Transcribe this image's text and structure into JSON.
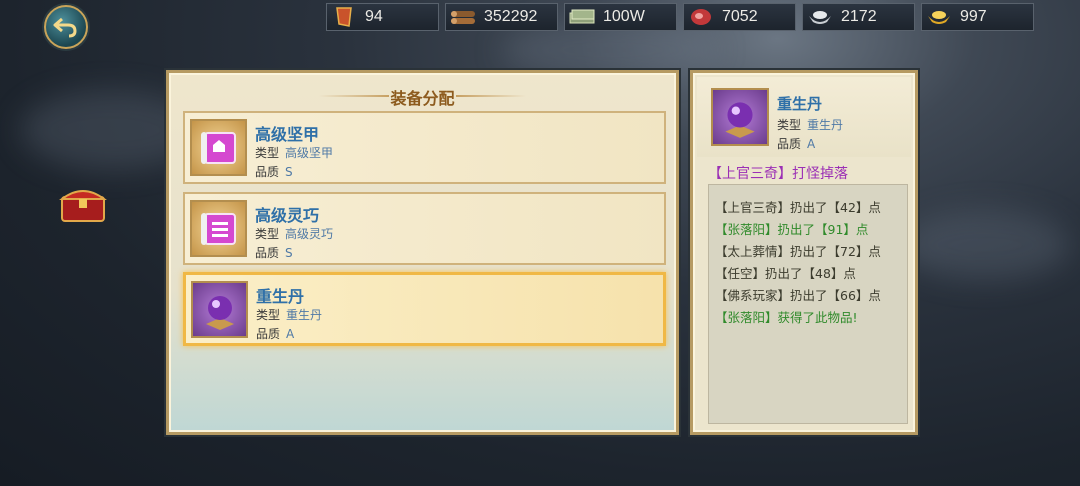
{
  "resources": [
    {
      "icon": "token-icon",
      "value": "94"
    },
    {
      "icon": "wood-icon",
      "value": "352292"
    },
    {
      "icon": "money-icon",
      "value": "100W"
    },
    {
      "icon": "meat-icon",
      "value": "7052"
    },
    {
      "icon": "silver-icon",
      "value": "2172"
    },
    {
      "icon": "gold-ingot-icon",
      "value": "997"
    }
  ],
  "left_panel": {
    "title": "装备分配",
    "items": [
      {
        "name": "高级坚甲",
        "type_label": "类型",
        "type": "高级坚甲",
        "quality_label": "品质",
        "quality": "S"
      },
      {
        "name": "高级灵巧",
        "type_label": "类型",
        "type": "高级灵巧",
        "quality_label": "品质",
        "quality": "S"
      },
      {
        "name": "重生丹",
        "type_label": "类型",
        "type": "重生丹",
        "quality_label": "品质",
        "quality": "A"
      }
    ]
  },
  "detail": {
    "name": "重生丹",
    "type_label": "类型",
    "type": "重生丹",
    "quality_label": "品质",
    "quality": "A",
    "source": "【上官三奇】打怪掉落",
    "log": [
      {
        "text": "【上官三奇】扔出了【42】点",
        "color": "dark"
      },
      {
        "text": "【张落阳】扔出了【91】点",
        "color": "green"
      },
      {
        "text": "【太上葬情】扔出了【72】点",
        "color": "dark"
      },
      {
        "text": "【任空】扔出了【48】点",
        "color": "dark"
      },
      {
        "text": "【佛系玩家】扔出了【66】点",
        "color": "dark"
      },
      {
        "text": "【张落阳】获得了此物品!",
        "color": "green"
      }
    ]
  }
}
